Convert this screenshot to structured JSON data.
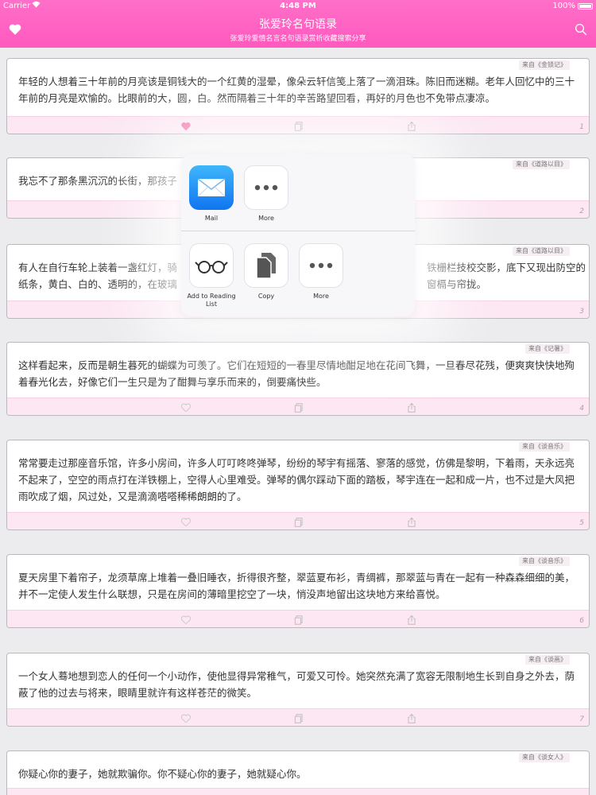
{
  "status_bar": {
    "carrier": "Carrier",
    "time": "4:48 PM",
    "battery": "100%"
  },
  "nav": {
    "title": "张爱玲名句语录",
    "subtitle": "张爱玲爱情名言名句语录赏析收藏搜索分享",
    "left_icon": "heart-icon",
    "right_icon": "search-icon"
  },
  "colors": {
    "accent": "#ff5fc2",
    "action_bar": "#fce7f2"
  },
  "quotes": [
    {
      "source": "来自《金锁记》",
      "text": "年轻的人想着三十年前的月亮该是铜钱大的一个红黄的湿晕，像朵云轩信笺上落了一滴泪珠。陈旧而迷糊。老年人回忆中的三十年前的月亮是欢愉的。比眼前的大，圆，白。然而隔着三十年的辛苦路望回看，再好的月色也不免带点凄凉。",
      "number": "1",
      "liked": true
    },
    {
      "source": "来自《道路以目》",
      "text": "我忘不了那条黑沉沉的长街，那孩子",
      "number": "2",
      "liked": false
    },
    {
      "source": "来自《道路以目》",
      "text_left": "有人在自行车轮上装着一盏红灯，骑",
      "text_right": "铁栅栏技校交影，底下又现出防空的",
      "text_line2_left": "纸条，黄白、白的、透明的，在玻璃",
      "text_line2_right": "窗槅与帘拢。",
      "number": "3",
      "liked": false
    },
    {
      "source": "来自《记暑》",
      "text": "这样看起来，反而是朝生暮死的蝴蝶为可羡了。它们在短短的一春里尽情地酣足地在花间飞舞，一旦春尽花残，便爽爽快快地殉着春光化去，好像它们一生只是为了酣舞与享乐而来的，倒要痛快些。",
      "number": "4",
      "liked": false
    },
    {
      "source": "来自《谈音乐》",
      "text": "常常要走过那座音乐馆，许多小房间，许多人叮叮咚咚弹琴，纷纷的琴宇有摇落、寥落的感觉，仿佛是黎明，下着雨，天永远亮不起来了，空空的雨点打在洋铁棚上，空得人心里难受。弹琴的偶尔踩动下面的踏板，琴宇连在一起和成一片，也不过是大风把雨吹成了烟，风过处，又是滴滴嗒嗒稀稀朗朗的了。",
      "number": "5",
      "liked": false
    },
    {
      "source": "来自《谈音乐》",
      "text": "夏天房里下着帘子，龙须草席上堆着一叠旧睡衣，折得很齐整，翠蓝夏布衫，青绸裤，那翠蓝与青在一起有一种森森细细的美，并不一定使人发生什么联想，只是在房间的薄暗里挖空了一块，悄没声地留出这块地方来给喜悦。",
      "number": "6",
      "liked": false
    },
    {
      "source": "来自《谈画》",
      "text": "一个女人蓦地想到恋人的任何一个小动作，使他显得异常稚气，可爱又可怜。她突然充满了宽容无限制地生长到自身之外去，荫蔽了他的过去与将来，眼睛里就许有这样苍茫的微笑。",
      "number": "7",
      "liked": false
    },
    {
      "source": "来自《谈女人》",
      "text": "你疑心你的妻子，她就欺骗你。你不疑心你的妻子，她就疑心你。",
      "number": "8",
      "liked": false
    }
  ],
  "share_sheet": {
    "row1": [
      {
        "label": "Mail",
        "icon": "mail-icon"
      },
      {
        "label": "More",
        "icon": "more-icon"
      }
    ],
    "row2": [
      {
        "label": "Add to Reading List",
        "icon": "glasses-icon"
      },
      {
        "label": "Copy",
        "icon": "copy-icon"
      },
      {
        "label": "More",
        "icon": "more-icon"
      }
    ]
  }
}
